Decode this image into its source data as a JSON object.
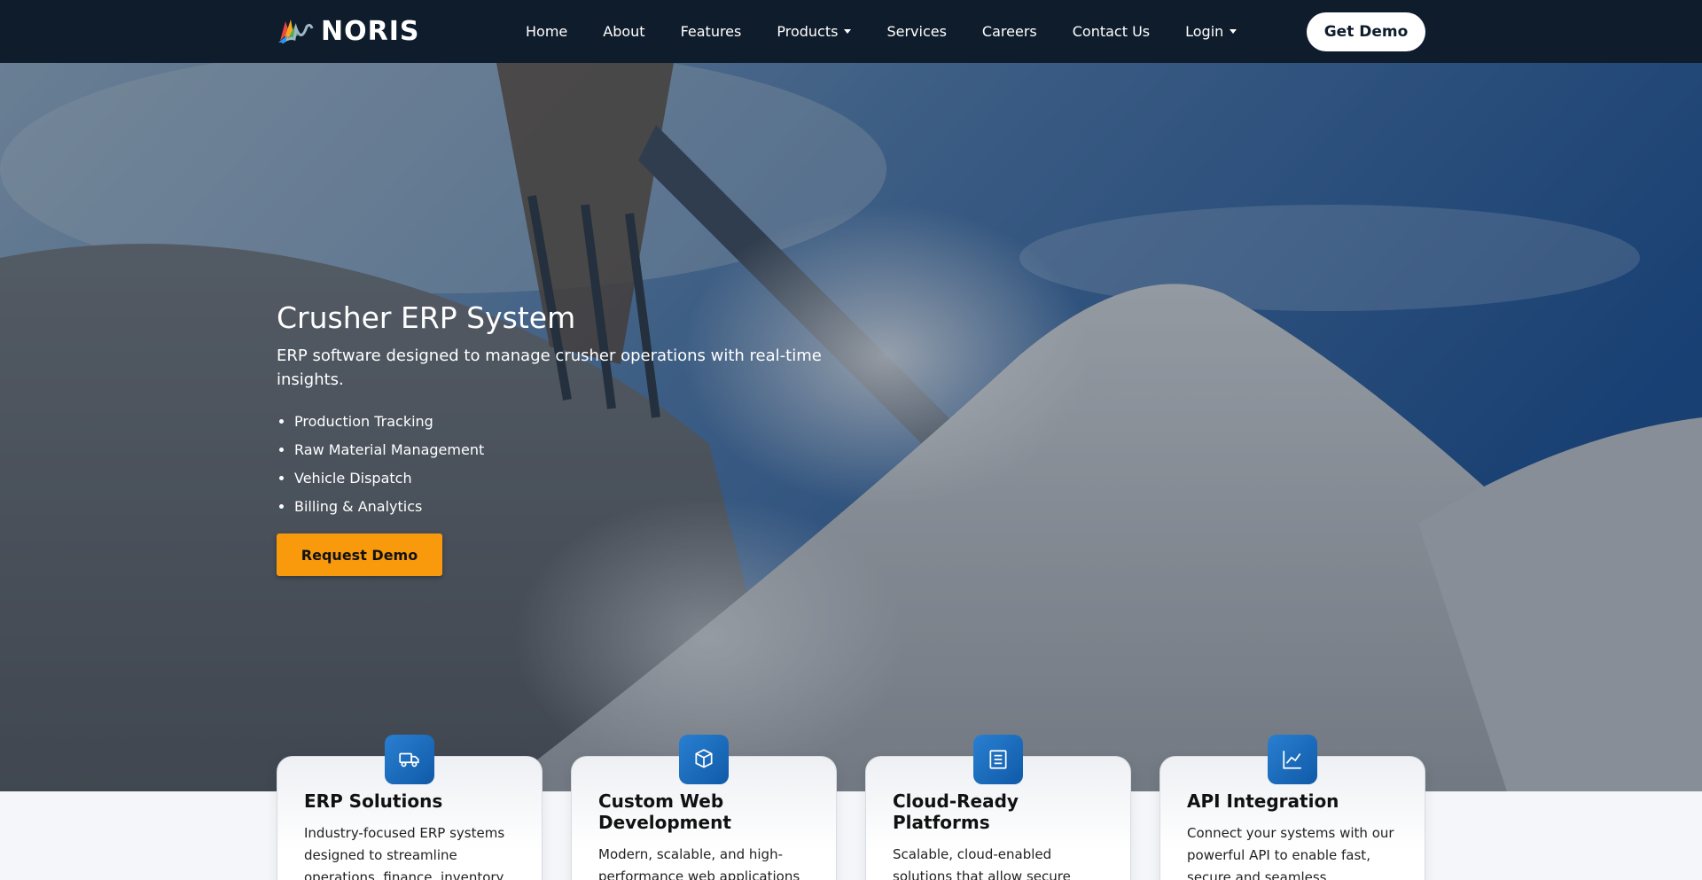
{
  "brand": {
    "name": "NORIS"
  },
  "nav": {
    "items": [
      {
        "label": "Home"
      },
      {
        "label": "About"
      },
      {
        "label": "Features"
      },
      {
        "label": "Products"
      },
      {
        "label": "Services"
      },
      {
        "label": "Careers"
      },
      {
        "label": "Contact Us"
      },
      {
        "label": "Login"
      }
    ],
    "cta": "Get Demo"
  },
  "hero": {
    "title": "Crusher ERP System",
    "subtitle": "ERP software designed to manage crusher operations with real-time insights.",
    "features": [
      "Production Tracking",
      "Raw Material Management",
      "Vehicle Dispatch",
      "Billing & Analytics"
    ],
    "cta": "Request Demo"
  },
  "cards": [
    {
      "icon": "truck-icon",
      "title": "ERP Solutions",
      "desc": "Industry-focused ERP systems designed to streamline operations, finance, inventory"
    },
    {
      "icon": "box-icon",
      "title": "Custom Web Development",
      "desc": "Modern, scalable, and high-performance web applications"
    },
    {
      "icon": "document-icon",
      "title": "Cloud-Ready Platforms",
      "desc": "Scalable, cloud-enabled solutions that allow secure"
    },
    {
      "icon": "chart-icon",
      "title": "API Integration",
      "desc": "Connect your systems with our powerful API to enable fast, secure and seamless"
    }
  ],
  "colors": {
    "navbar": "#0f1c2c",
    "accent": "#f99a0d",
    "icon_tile": "#1a6cc0"
  }
}
